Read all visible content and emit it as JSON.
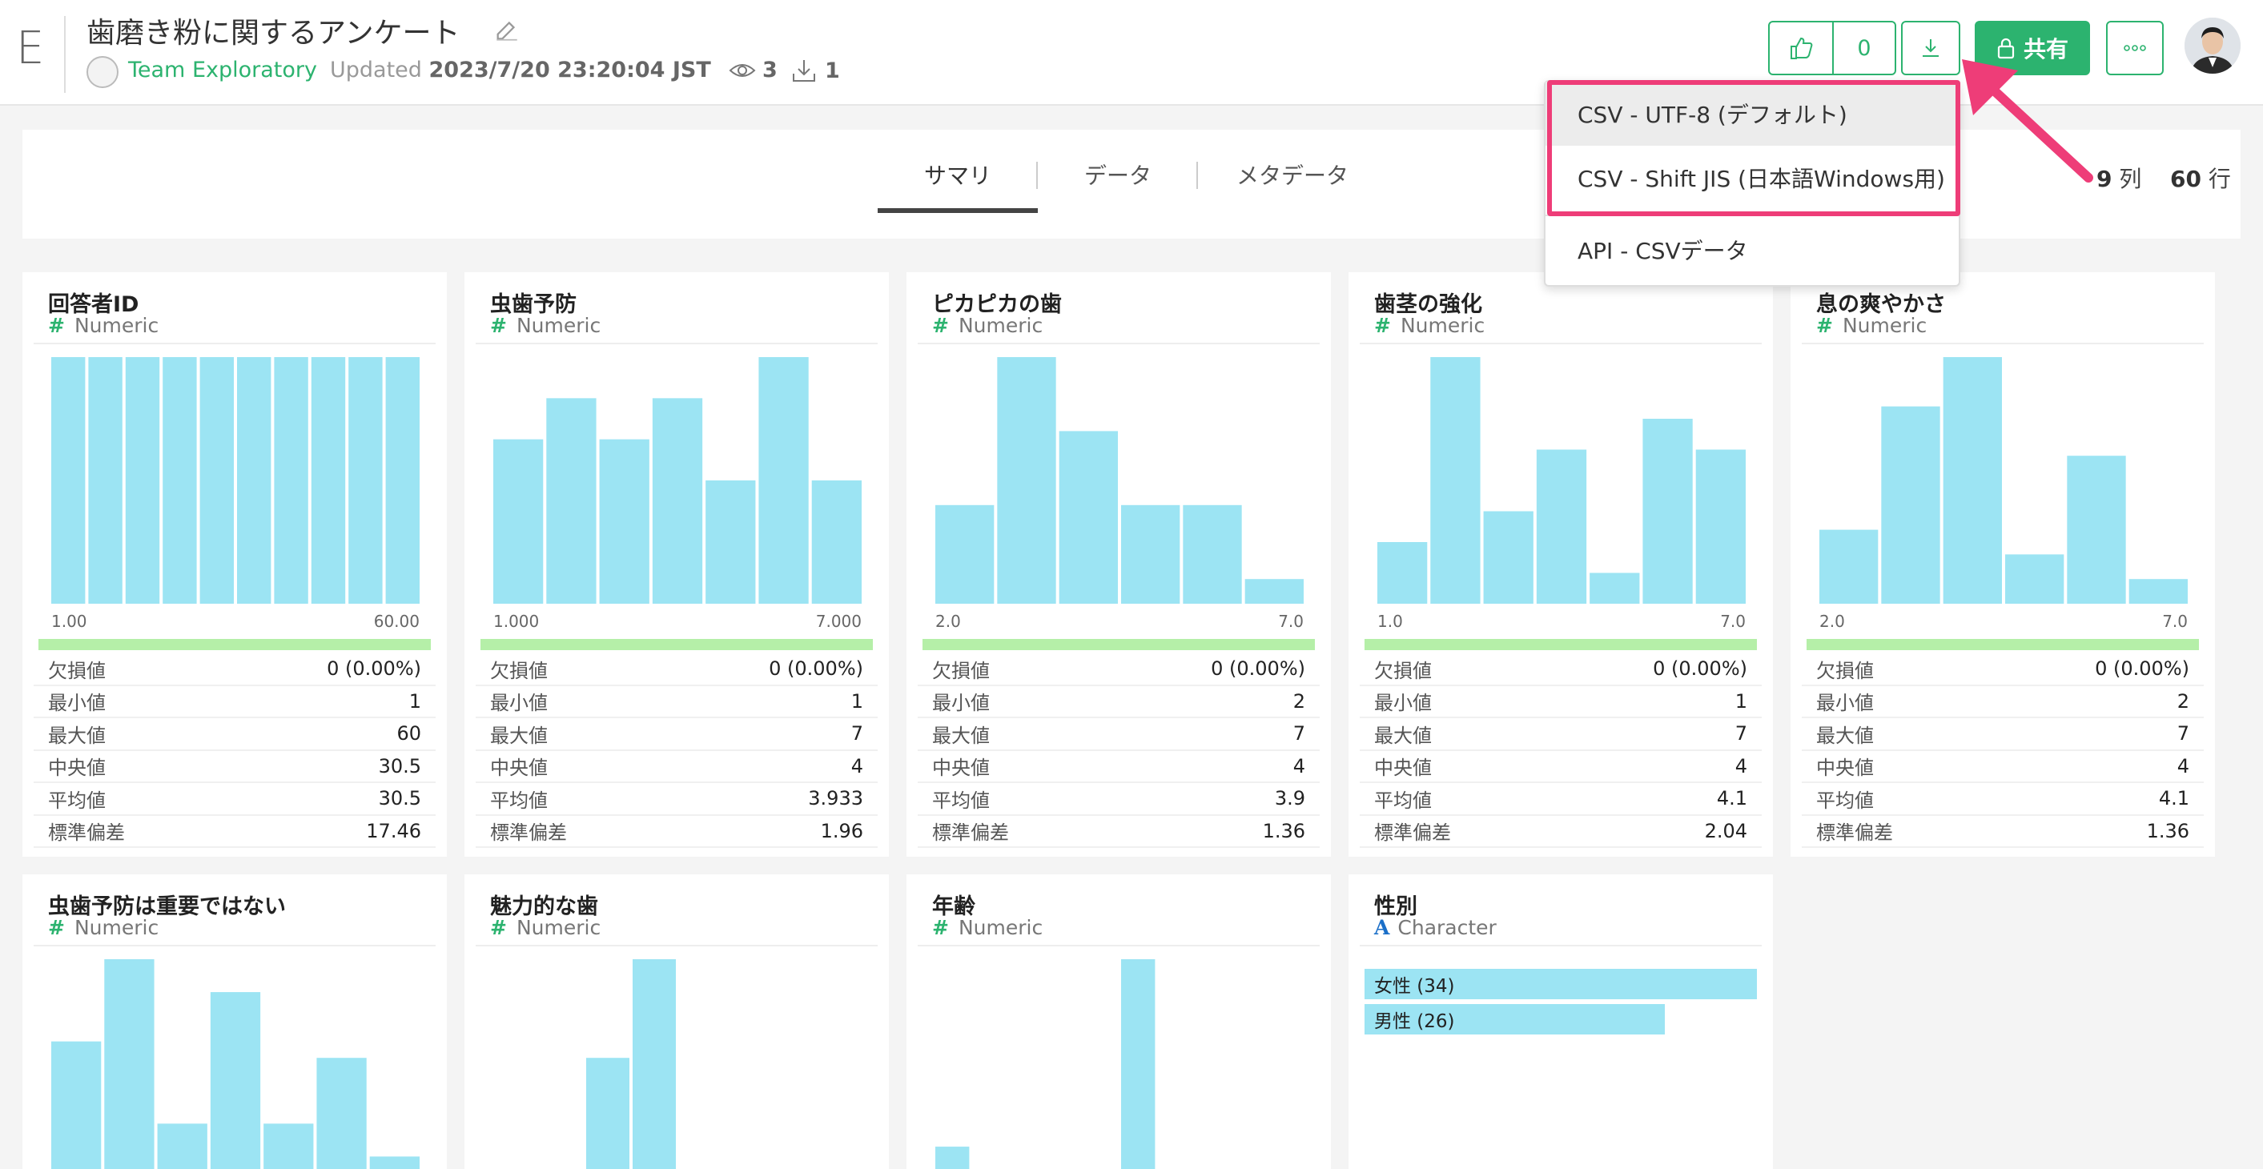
{
  "header": {
    "logo": "E",
    "title": "歯磨き粉に関するアンケート",
    "team": "Team Exploratory",
    "updated_label": "Updated",
    "updated_value": "2023/7/20 23:20:04 JST",
    "views": "3",
    "downloads": "1",
    "likes": "0",
    "share_label": "共有",
    "accent_color": "#2cb36f"
  },
  "tabs": {
    "summary": "サマリ",
    "data": "データ",
    "metadata": "メタデータ",
    "columns_count": "9",
    "columns_unit": "列",
    "rows_count": "60",
    "rows_unit": "行"
  },
  "download_menu": {
    "items": [
      "CSV - UTF-8 (デフォルト)",
      "CSV - Shift JIS (日本語Windows用)",
      "API - CSVデータ"
    ],
    "highlight_color": "#ee3d78"
  },
  "stat_labels": [
    "欠損値",
    "最小値",
    "最大値",
    "中央値",
    "平均値",
    "標準偏差"
  ],
  "columns": [
    {
      "name": "回答者ID",
      "type": "Numeric",
      "range_min": "1.00",
      "range_max": "60.00",
      "hist": [
        6,
        6,
        6,
        6,
        6,
        6,
        6,
        6,
        6,
        6
      ],
      "stats": [
        "0 (0.00%)",
        "1",
        "60",
        "30.5",
        "30.5",
        "17.46"
      ]
    },
    {
      "name": "虫歯予防",
      "type": "Numeric",
      "range_min": "1.000",
      "range_max": "7.000",
      "hist": [
        4,
        5,
        4,
        5,
        3,
        6,
        3
      ],
      "stats": [
        "0 (0.00%)",
        "1",
        "7",
        "4",
        "3.933",
        "1.96"
      ]
    },
    {
      "name": "ピカピカの歯",
      "type": "Numeric",
      "range_min": "2.0",
      "range_max": "7.0",
      "hist": [
        8,
        20,
        14,
        8,
        8,
        2
      ],
      "stats": [
        "0 (0.00%)",
        "2",
        "7",
        "4",
        "3.9",
        "1.36"
      ]
    },
    {
      "name": "歯茎の強化",
      "type": "Numeric",
      "range_min": "1.0",
      "range_max": "7.0",
      "hist": [
        5,
        20,
        7.5,
        12.5,
        2.5,
        15,
        12.5
      ],
      "stats": [
        "0 (0.00%)",
        "1",
        "7",
        "4",
        "4.1",
        "2.04"
      ]
    },
    {
      "name": "息の爽やかさ",
      "type": "Numeric",
      "range_min": "2.0",
      "range_max": "7.0",
      "hist": [
        6,
        16,
        20,
        4,
        12,
        2
      ],
      "stats": [
        "0 (0.00%)",
        "2",
        "7",
        "4",
        "4.1",
        "1.36"
      ]
    },
    {
      "name": "虫歯予防は重要ではない",
      "type": "Numeric",
      "hist": [
        10,
        15,
        5,
        13,
        5,
        9,
        3
      ]
    },
    {
      "name": "魅力的な歯",
      "type": "Numeric",
      "hist": [
        0,
        0,
        9,
        15,
        0,
        0,
        1.4,
        1.4
      ]
    },
    {
      "name": "年齢",
      "type": "Numeric",
      "hist": [
        3.6,
        1.8,
        0.4,
        1.8,
        0.4,
        15,
        0,
        0,
        0,
        1.8
      ]
    },
    {
      "name": "性別",
      "type": "Character",
      "categories": [
        {
          "label": "女性 (34)",
          "value": 34
        },
        {
          "label": "男性 (26)",
          "value": 26
        }
      ]
    }
  ],
  "bar_color": "#9ce4f3"
}
